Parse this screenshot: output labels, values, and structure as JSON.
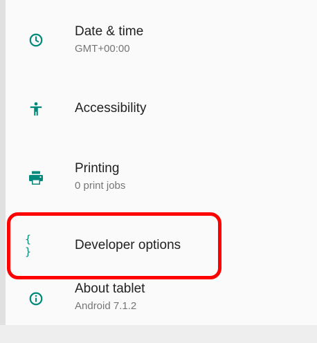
{
  "settings": {
    "items": [
      {
        "title": "Date & time",
        "summary": "GMT+00:00",
        "icon": "clock-icon"
      },
      {
        "title": "Accessibility",
        "summary": "",
        "icon": "accessibility-icon"
      },
      {
        "title": "Printing",
        "summary": "0 print jobs",
        "icon": "printer-icon"
      },
      {
        "title": "Developer options",
        "summary": "",
        "icon": "braces-icon",
        "icon_glyph": "{ }"
      },
      {
        "title": "About tablet",
        "summary": "Android 7.1.2",
        "icon": "info-icon"
      }
    ]
  },
  "highlight": {
    "color": "#ff0000",
    "target": "Developer options"
  },
  "colors": {
    "icon_tint": "#00897b",
    "title": "#212121",
    "summary": "#757575"
  }
}
